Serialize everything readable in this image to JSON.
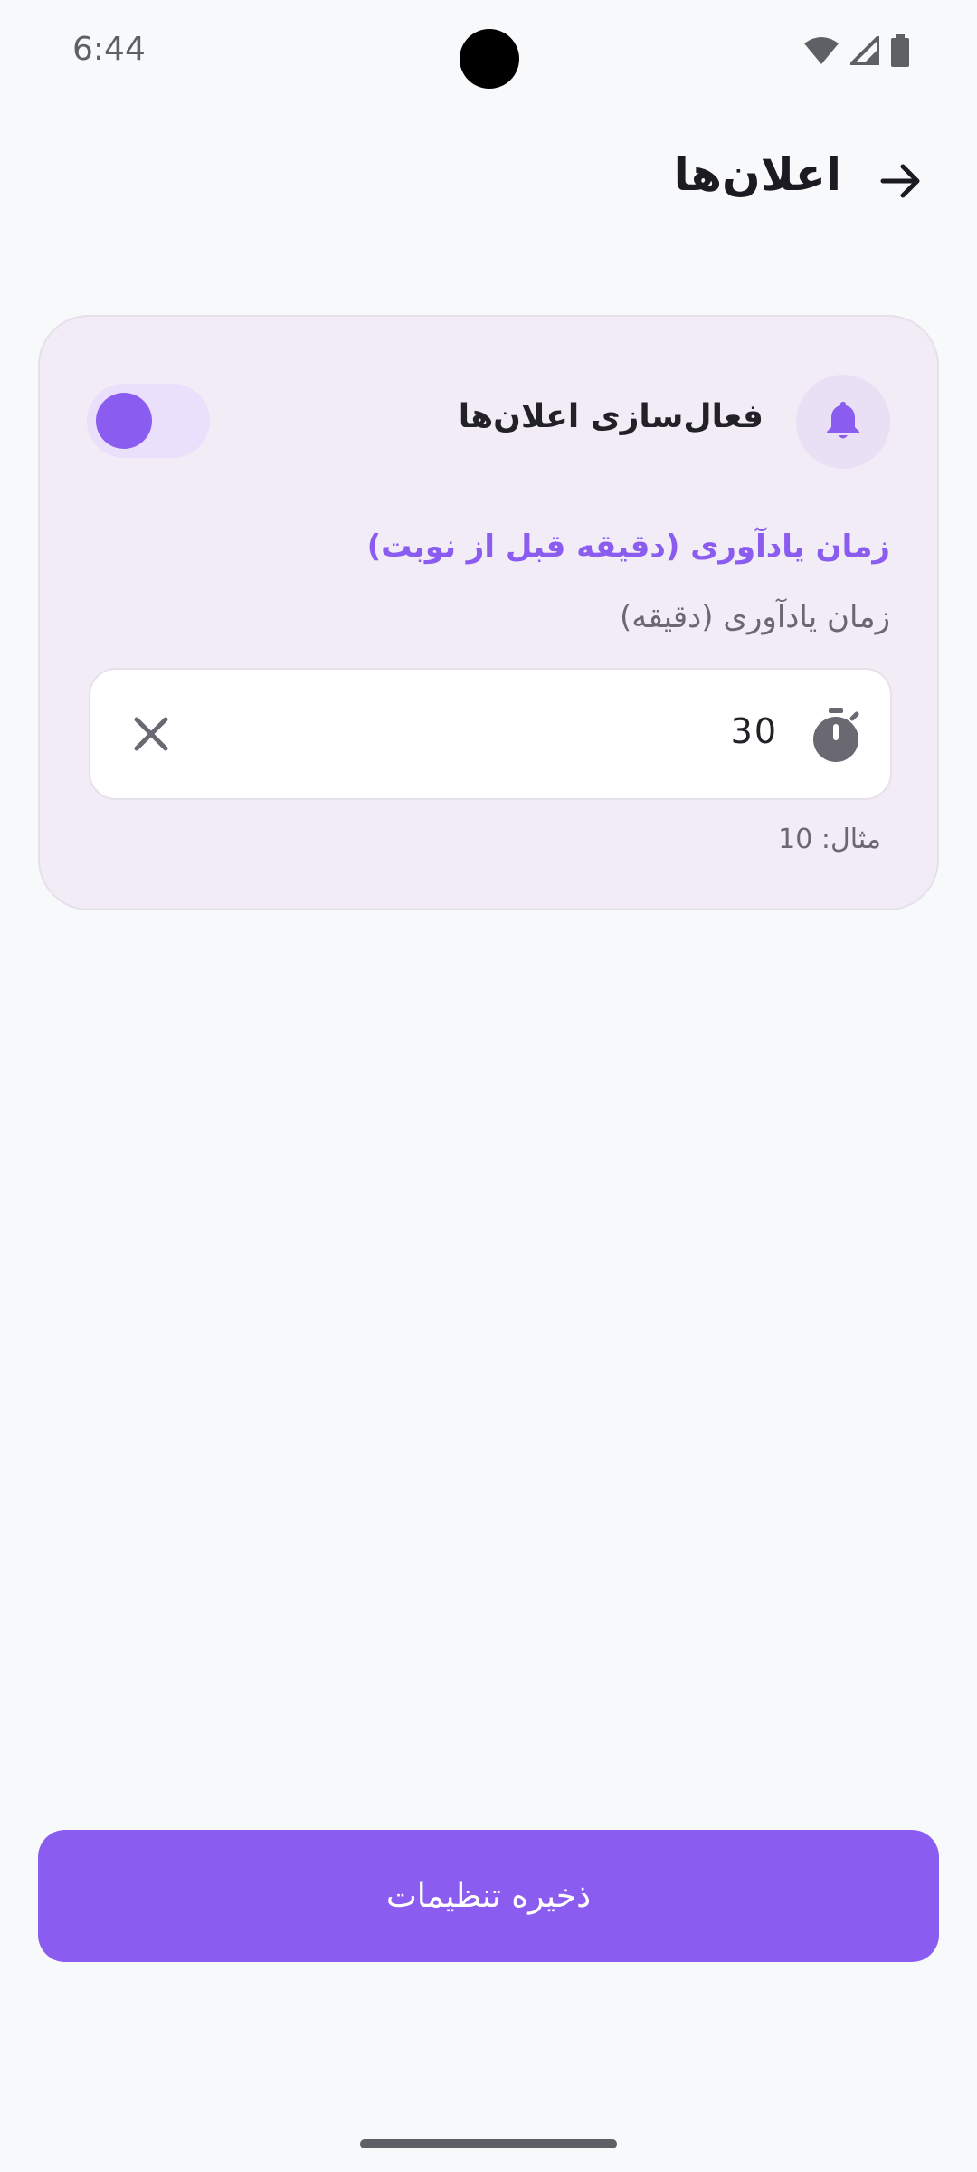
{
  "status_bar": {
    "time": "6:44",
    "icons": [
      "wifi-icon",
      "signal-icon",
      "battery-icon"
    ]
  },
  "header": {
    "title": "اعلان‌ها",
    "back_icon": "arrow-right-icon"
  },
  "card": {
    "enable_label": "فعال‌سازی اعلان‌ها",
    "bell_icon": "bell-icon",
    "toggle_on": true,
    "section_title": "زمان یادآوری (دقیقه قبل از نوبت)",
    "field_label": "زمان یادآوری (دقیقه)",
    "input_value": "30",
    "input_icon": "timer-icon",
    "clear_icon": "close-icon",
    "helper_text": "مثال: 10"
  },
  "footer": {
    "save_label": "ذخیره تنظیمات"
  },
  "colors": {
    "accent": "#8b5cf0",
    "background": "#f8f9fb",
    "card": "#f2ecf6"
  }
}
